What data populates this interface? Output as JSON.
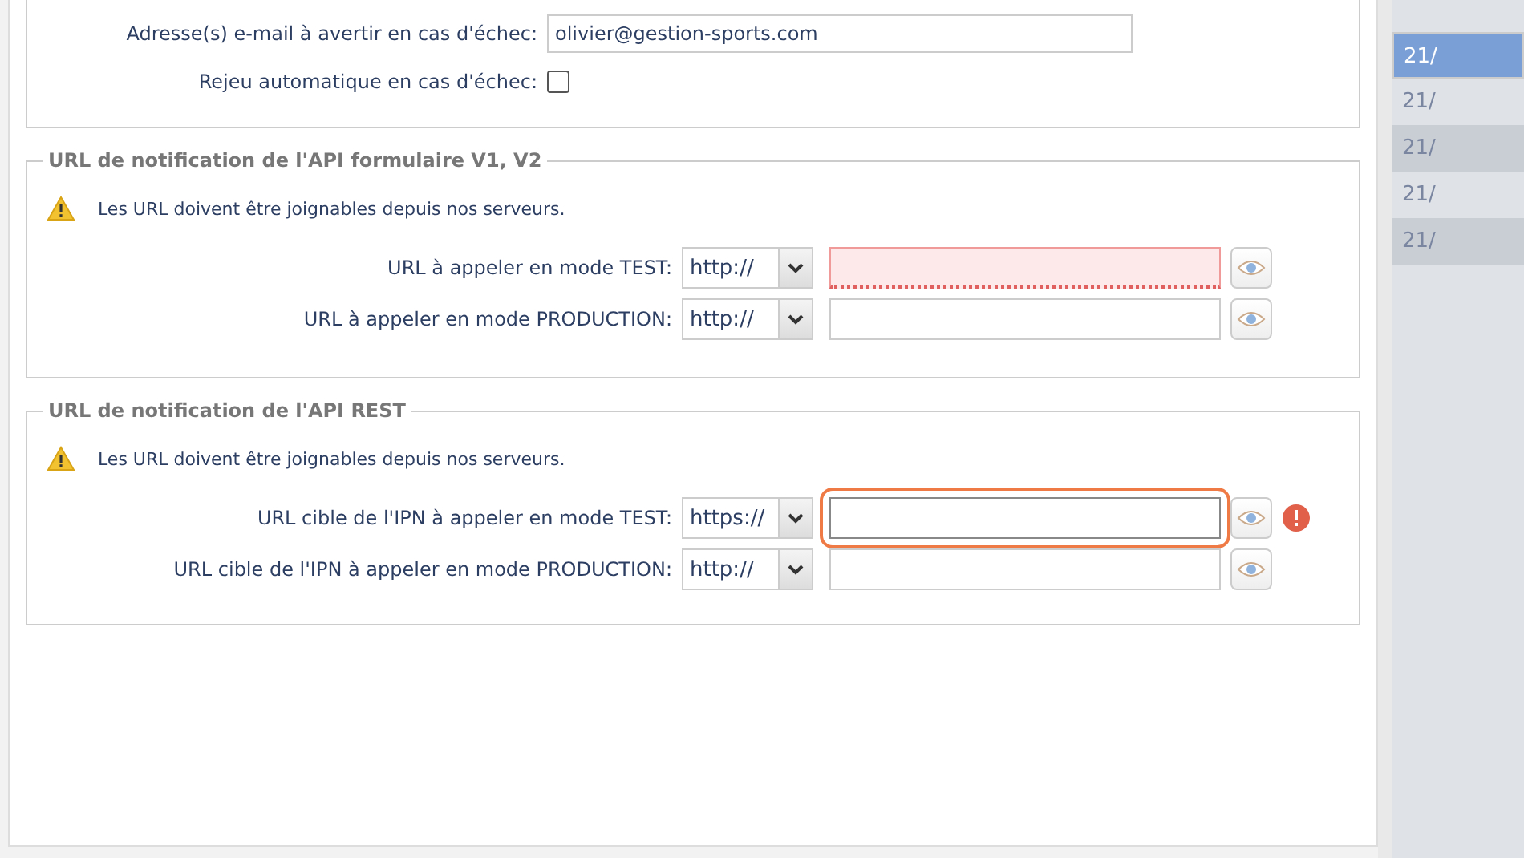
{
  "notifications": {
    "fields": [
      {
        "kind": "text",
        "label": "Adresse(s) e-mail à avertir en cas d'échec:",
        "value": "olivier@gestion-sports.com"
      },
      {
        "kind": "checkbox",
        "label": "Rejeu automatique en cas d'échec:",
        "checked": false
      }
    ]
  },
  "fieldsets": [
    {
      "legend": "URL de notification de l'API formulaire V1, V2",
      "warning": "Les URL doivent être joignables depuis nos serveurs.",
      "rows": [
        {
          "label": "URL à appeler en mode TEST:",
          "protocol": "http://",
          "invalid": true,
          "focused": false,
          "error": false
        },
        {
          "label": "URL à appeler en mode PRODUCTION:",
          "protocol": "http://",
          "invalid": false,
          "focused": false,
          "error": false
        }
      ]
    },
    {
      "legend": "URL de notification de l'API REST",
      "warning": "Les URL doivent être joignables depuis nos serveurs.",
      "rows": [
        {
          "label": "URL cible de l'IPN à appeler en mode TEST:",
          "protocol": "https://",
          "invalid": false,
          "focused": true,
          "error": true
        },
        {
          "label": "URL cible de l'IPN à appeler en mode PRODUCTION:",
          "protocol": "http://",
          "invalid": false,
          "focused": false,
          "error": false
        }
      ]
    }
  ],
  "sidebar": {
    "items": [
      {
        "label": "21/",
        "selected": true
      },
      {
        "label": "21/",
        "selected": false
      },
      {
        "label": "21/",
        "selected": false
      },
      {
        "label": "21/",
        "selected": false
      },
      {
        "label": "21/",
        "selected": false
      }
    ]
  }
}
